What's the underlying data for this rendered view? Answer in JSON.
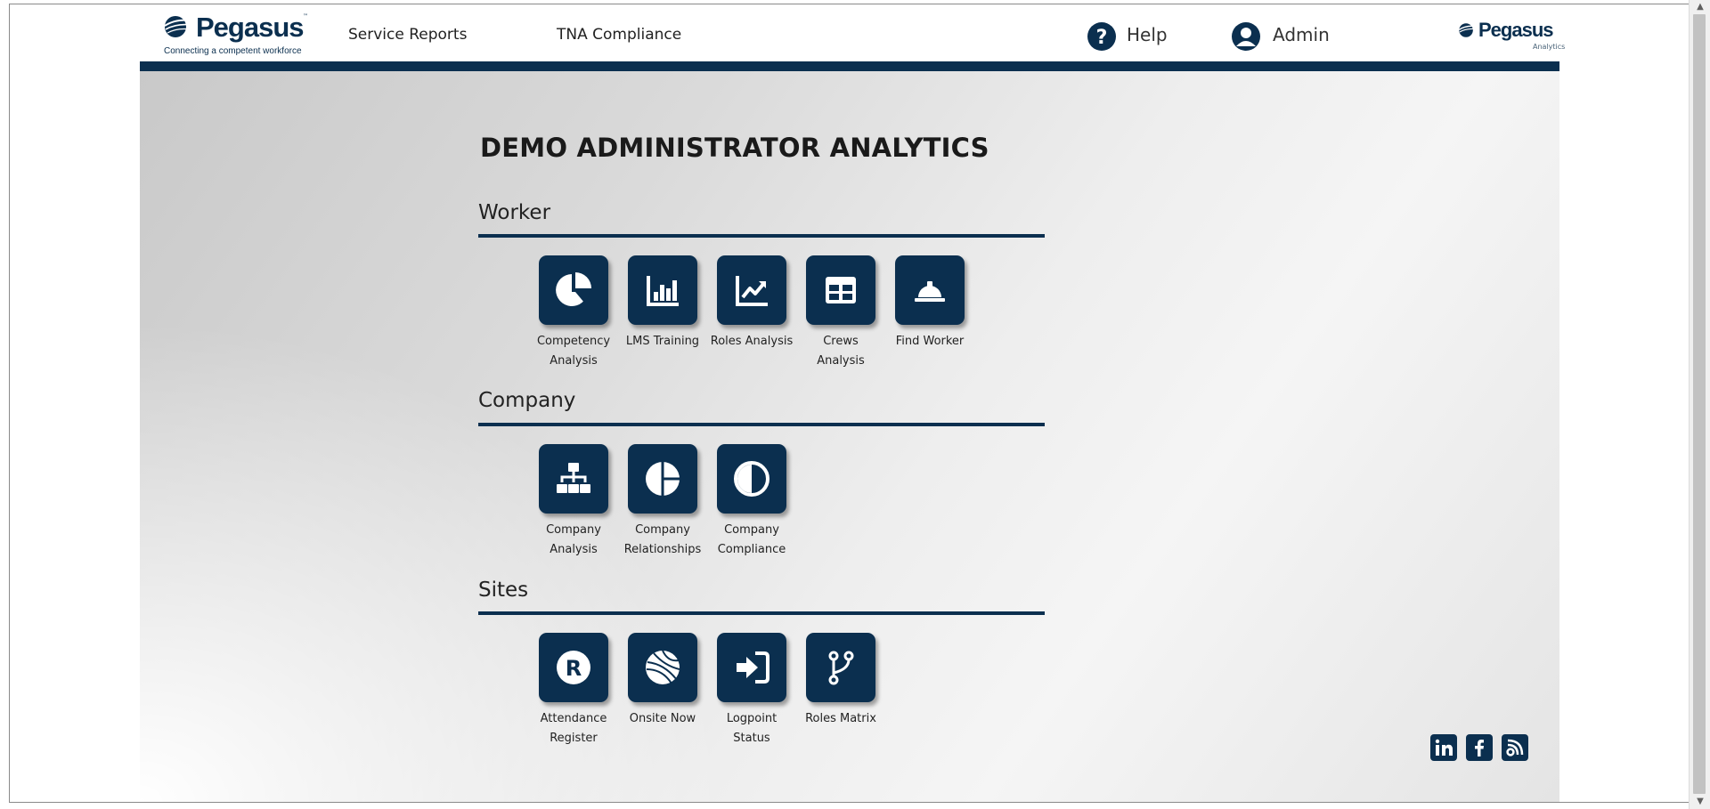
{
  "header": {
    "logo_main": {
      "wordmark": "Pegasus",
      "trademark": "™",
      "tagline": "Connecting a competent workforce"
    },
    "nav": {
      "service_reports": "Service Reports",
      "tna_compliance": "TNA Compliance",
      "help": "Help",
      "admin": "Admin"
    },
    "logo_small": {
      "wordmark": "Pegasus",
      "subtitle": "Analytics"
    }
  },
  "page": {
    "title": "DEMO ADMINISTRATOR ANALYTICS"
  },
  "sections": [
    {
      "title": "Worker",
      "tiles": [
        {
          "label": "Competency Analysis",
          "icon": "pie-chart-icon"
        },
        {
          "label": "LMS Training",
          "icon": "bar-chart-icon"
        },
        {
          "label": "Roles Analysis",
          "icon": "trend-line-icon"
        },
        {
          "label": "Crews Analysis",
          "icon": "table-grid-icon"
        },
        {
          "label": "Find Worker",
          "icon": "hard-hat-icon"
        }
      ]
    },
    {
      "title": "Company",
      "tiles": [
        {
          "label": "Company Analysis",
          "icon": "org-chart-icon"
        },
        {
          "label": "Company Relationships",
          "icon": "pie-quarters-icon"
        },
        {
          "label": "Company Compliance",
          "icon": "half-circle-icon"
        }
      ]
    },
    {
      "title": "Sites",
      "tiles": [
        {
          "label": "Attendance Register",
          "icon": "registered-r-icon"
        },
        {
          "label": "Onsite Now",
          "icon": "satellite-dish-icon"
        },
        {
          "label": "Logpoint Status",
          "icon": "sign-in-icon"
        },
        {
          "label": "Roles Matrix",
          "icon": "branch-icon"
        }
      ]
    }
  ],
  "footer": {
    "social": [
      "linkedin-icon",
      "facebook-icon",
      "blog-rss-icon"
    ]
  },
  "colors": {
    "brand_navy": "#0b2f4f",
    "text": "#222222"
  }
}
